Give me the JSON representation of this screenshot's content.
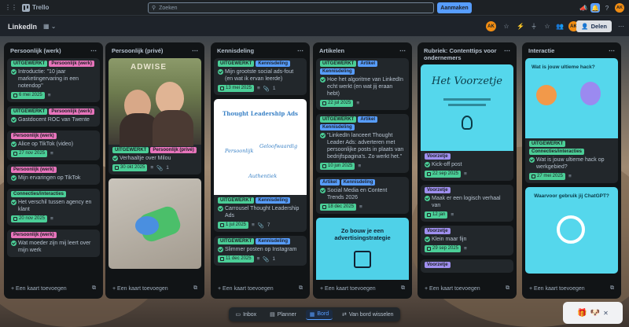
{
  "app": {
    "name": "Trello"
  },
  "search": {
    "placeholder": "Zoeken"
  },
  "create_label": "Aanmaken",
  "board": {
    "name": "LinkedIn",
    "share_label": "Delen",
    "avatar": "AK"
  },
  "lists": [
    {
      "title": "Persoonlijk (werk)",
      "add_label": "Een kaart toevoegen",
      "cards": [
        {
          "labels": [
            {
              "text": "UITGEWERKT",
              "color": "green"
            },
            {
              "text": "Persoonlijk (werk)",
              "color": "pink"
            }
          ],
          "title": "Introductie: \"10 jaar marketingervaring in een notendop\"",
          "due": "6 mei 2025",
          "attach": ""
        },
        {
          "labels": [
            {
              "text": "UITGEWERKT",
              "color": "green"
            },
            {
              "text": "Persoonlijk (werk)",
              "color": "pink"
            }
          ],
          "title": "Gastdocent ROC van Twente",
          "due": "",
          "attach": ""
        },
        {
          "labels": [
            {
              "text": "Persoonlijk (werk)",
              "color": "pink"
            }
          ],
          "title": "Alice op TikTok (video)",
          "due": "27 nov 2025",
          "attach": ""
        },
        {
          "labels": [
            {
              "text": "Persoonlijk (werk)",
              "color": "pink"
            }
          ],
          "title": "Mijn ervaringen op TikTok",
          "due": "",
          "attach": ""
        },
        {
          "labels": [
            {
              "text": "Connecties/interacties",
              "color": "green"
            }
          ],
          "title": "Het verschil tussen agency en klant",
          "due": "20 nov 2025",
          "attach": ""
        },
        {
          "labels": [
            {
              "text": "Persoonlijk (werk)",
              "color": "pink"
            }
          ],
          "title": "Wat moeder zijn mij leert over mijn werk",
          "due": "",
          "attach": ""
        }
      ]
    },
    {
      "title": "Persoonlijk (privé)",
      "add_label": "Een kaart toevoegen",
      "cards": [
        {
          "cover": "photo-selfie",
          "cover_text": "ADWISE",
          "labels": [
            {
              "text": "UITGEWERKT",
              "color": "green"
            },
            {
              "text": "Persoonlijk (privé)",
              "color": "pink"
            }
          ],
          "title": "Verhaaltje over Milou",
          "due": "30 okt 2025",
          "attach": "1"
        },
        {
          "cover": "photo-hand",
          "labels": [],
          "title": "",
          "due": "",
          "attach": ""
        }
      ]
    },
    {
      "title": "Kennisdeling",
      "add_label": "Een kaart toevoegen",
      "cards": [
        {
          "labels": [
            {
              "text": "UITGEWERKT",
              "color": "green"
            },
            {
              "text": "Kennisdeling",
              "color": "blue"
            }
          ],
          "title": "Mijn grootste social ads-fout (en wat ik ervan leerde)",
          "due": "13 mei 2025",
          "attach": "1"
        },
        {
          "cover": "graphic-thought",
          "cover_title": "Thought Leadership Ads",
          "cover_words": [
            "Persoonlijk",
            "Geloofwaardig",
            "Authentiek"
          ],
          "labels": [
            {
              "text": "UITGEWERKT",
              "color": "green"
            },
            {
              "text": "Kennisdeling",
              "color": "blue"
            }
          ],
          "title": "Carrousel Thought Leadership Ads",
          "due": "1 jul 2025",
          "attach": "7"
        },
        {
          "labels": [
            {
              "text": "UITGEWERKT",
              "color": "green"
            },
            {
              "text": "Kennisdeling",
              "color": "blue"
            }
          ],
          "title": "Slimmer posten op Instagram",
          "due": "11 dec 2025",
          "attach": "1"
        }
      ]
    },
    {
      "title": "Artikelen",
      "add_label": "Een kaart toevoegen",
      "cards": [
        {
          "labels": [
            {
              "text": "UITGEWERKT",
              "color": "green"
            },
            {
              "text": "Artikel",
              "color": "blue"
            },
            {
              "text": "Kennisdeling",
              "color": "blue"
            }
          ],
          "title": "Hoe het algoritme van LinkedIn echt werkt (en wat jij eraan hebt)",
          "due": "22 jul 2025",
          "attach": ""
        },
        {
          "labels": [
            {
              "text": "UITGEWERKT",
              "color": "green"
            },
            {
              "text": "Artikel",
              "color": "blue"
            },
            {
              "text": "Kennisdeling",
              "color": "blue"
            }
          ],
          "title": "\"LinkedIn lanceert Thought Leader Ads: adverteren met persoonlijke posts in plaats van bedrijfspagina's. Zo werkt het.\"",
          "due": "10 jun 2025",
          "attach": ""
        },
        {
          "labels": [
            {
              "text": "Artikel",
              "color": "blue"
            },
            {
              "text": "Kennisdeling",
              "color": "blue"
            }
          ],
          "title": "Social Media en Content Trends 2026",
          "due": "18 dec 2025",
          "attach": ""
        },
        {
          "cover": "graphic-advert",
          "cover_title": "Zo bouw je een advertisingstrategie",
          "labels": [],
          "title": "",
          "due": "",
          "attach": ""
        }
      ]
    },
    {
      "title": "Rubriek: Contenttips voor ondernemers",
      "add_label": "Een kaart toevoegen",
      "cards": [
        {
          "cover": "graphic-voorzetje",
          "cover_title": "Het Voorzetje",
          "labels": [
            {
              "text": "Voorzetje",
              "color": "purple"
            }
          ],
          "title": "Kick-off post",
          "due": "22 sep 2025",
          "attach": ""
        },
        {
          "labels": [
            {
              "text": "Voorzetje",
              "color": "purple"
            }
          ],
          "title": "Maak er een logisch verhaal van",
          "due": "12 jan",
          "attach": ""
        },
        {
          "labels": [
            {
              "text": "Voorzetje",
              "color": "purple"
            }
          ],
          "title": "Klein maar fijn",
          "due": "29 sep 2025",
          "attach": ""
        },
        {
          "labels": [
            {
              "text": "Voorzetje",
              "color": "purple"
            }
          ],
          "title": "",
          "due": "",
          "attach": ""
        }
      ]
    },
    {
      "title": "Interactie",
      "add_label": "Een kaart toevoegen",
      "cards": [
        {
          "cover": "graphic-hack",
          "cover_title": "Wat is jouw ultieme hack?",
          "labels": [
            {
              "text": "UITGEWERKT",
              "color": "green"
            },
            {
              "text": "Connecties/interacties",
              "color": "green"
            }
          ],
          "title": "Wat is jouw ultieme hack op werkgebied?",
          "due": "27 mei 2025",
          "attach": ""
        },
        {
          "cover": "graphic-chatgpt",
          "cover_title": "Waarvoor gebruik jij ChatGPT?",
          "labels": [],
          "title": "",
          "due": "",
          "attach": ""
        }
      ]
    }
  ],
  "bottom_nav": {
    "inbox": "Inbox",
    "planner": "Planner",
    "board": "Bord",
    "switch": "Van bord wisselen"
  }
}
